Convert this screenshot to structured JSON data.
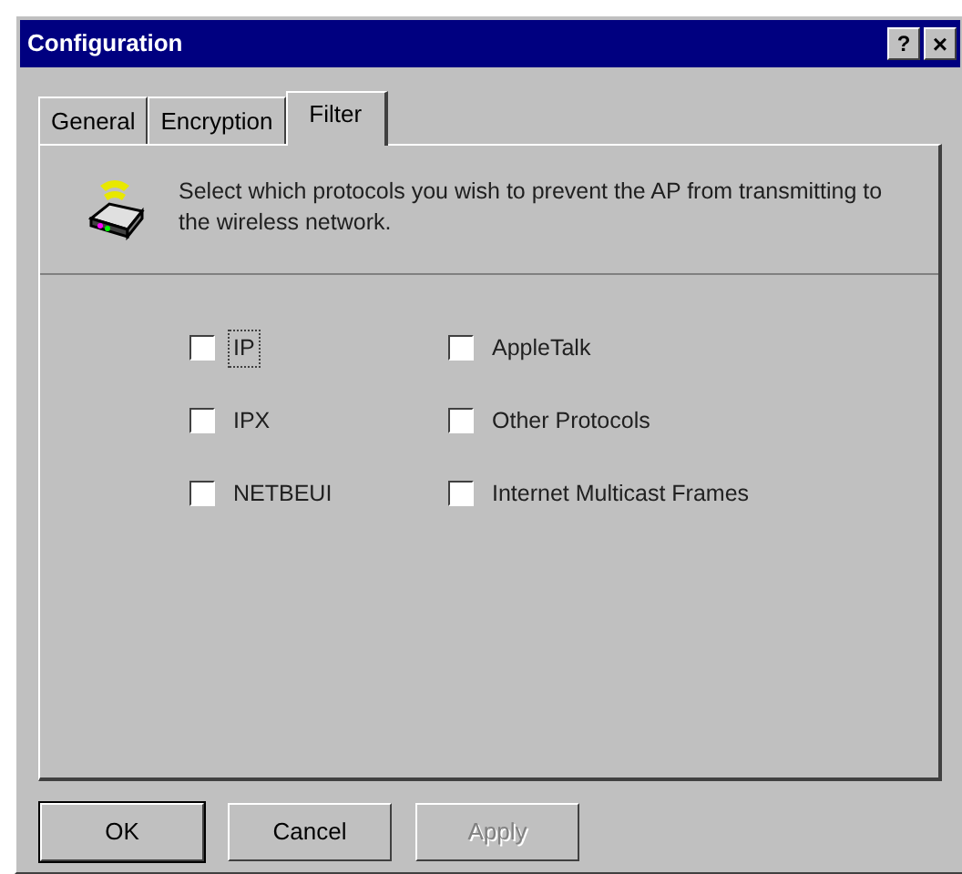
{
  "window": {
    "title": "Configuration",
    "help_button": "?",
    "close_button": "×"
  },
  "tabs": [
    {
      "label": "General",
      "selected": false
    },
    {
      "label": "Encryption",
      "selected": false
    },
    {
      "label": "Filter",
      "selected": true
    }
  ],
  "description": "Select which protocols you wish to prevent the AP from transmitting to the wireless network.",
  "protocols": [
    {
      "label": "IP",
      "checked": false,
      "focused": true
    },
    {
      "label": "AppleTalk",
      "checked": false,
      "focused": false
    },
    {
      "label": "IPX",
      "checked": false,
      "focused": false
    },
    {
      "label": "Other Protocols",
      "checked": false,
      "focused": false
    },
    {
      "label": "NETBEUI",
      "checked": false,
      "focused": false
    },
    {
      "label": "Internet Multicast Frames",
      "checked": false,
      "focused": false
    }
  ],
  "buttons": [
    {
      "label": "OK",
      "disabled": false,
      "default": true
    },
    {
      "label": "Cancel",
      "disabled": false,
      "default": false
    },
    {
      "label": "Apply",
      "disabled": true,
      "default": false
    }
  ]
}
